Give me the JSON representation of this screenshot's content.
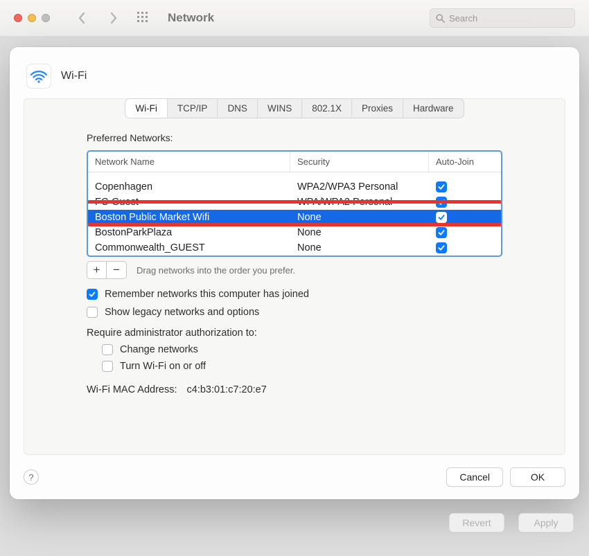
{
  "window": {
    "title": "Network",
    "search_placeholder": "Search"
  },
  "sheet": {
    "title": "Wi-Fi",
    "tabs": [
      "Wi-Fi",
      "TCP/IP",
      "DNS",
      "WINS",
      "802.1X",
      "Proxies",
      "Hardware"
    ],
    "active_tab_index": 0,
    "preferred_label": "Preferred Networks:",
    "columns": {
      "name": "Network Name",
      "security": "Security",
      "autojoin": "Auto-Join"
    },
    "networks": [
      {
        "name": "Copenhagen",
        "security": "WPA2/WPA3 Personal",
        "autojoin": true,
        "selected": false,
        "highlight": false
      },
      {
        "name": "FC-Guest",
        "security": "WPA/WPA2 Personal",
        "autojoin": true,
        "selected": false,
        "highlight": false
      },
      {
        "name": "Boston Public Market Wifi",
        "security": "None",
        "autojoin": true,
        "selected": true,
        "highlight": true
      },
      {
        "name": "BostonParkPlaza",
        "security": "None",
        "autojoin": true,
        "selected": false,
        "highlight": false
      },
      {
        "name": "Commonwealth_GUEST",
        "security": "None",
        "autojoin": true,
        "selected": false,
        "highlight": false
      }
    ],
    "drag_hint": "Drag networks into the order you prefer.",
    "remember": {
      "label": "Remember networks this computer has joined",
      "checked": true
    },
    "legacy": {
      "label": "Show legacy networks and options",
      "checked": false
    },
    "admin_label": "Require administrator authorization to:",
    "admin_opts": {
      "change": {
        "label": "Change networks",
        "checked": false
      },
      "toggle": {
        "label": "Turn Wi-Fi on or off",
        "checked": false
      }
    },
    "mac_label": "Wi-Fi MAC Address:",
    "mac_value": "c4:b3:01:c7:20:e7",
    "footer": {
      "cancel": "Cancel",
      "ok": "OK"
    }
  },
  "bottom": {
    "revert": "Revert",
    "apply": "Apply"
  },
  "glyph": {
    "plus": "+",
    "minus": "−",
    "help": "?"
  }
}
